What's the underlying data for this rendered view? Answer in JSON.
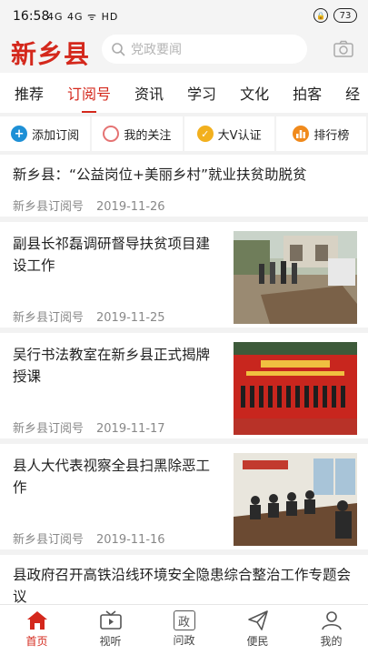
{
  "status_bar": {
    "time": "16:58",
    "signal_text": "4G 4G ᯤ HD",
    "battery": "73"
  },
  "header": {
    "logo": "新乡县",
    "search_placeholder": "党政要闻",
    "icons": [
      "search-icon",
      "camera-icon"
    ]
  },
  "tabs": [
    {
      "label": "推荐",
      "active": false
    },
    {
      "label": "订阅号",
      "active": true
    },
    {
      "label": "资讯",
      "active": false
    },
    {
      "label": "学习",
      "active": false
    },
    {
      "label": "文化",
      "active": false
    },
    {
      "label": "拍客",
      "active": false
    },
    {
      "label": "经",
      "active": false
    }
  ],
  "shortcuts": [
    {
      "label": "添加订阅",
      "icon": "plus-icon",
      "color": "#1e90d6"
    },
    {
      "label": "我的关注",
      "icon": "heart-circle-icon",
      "color": "#e57373"
    },
    {
      "label": "大V认证",
      "icon": "verified-v-icon",
      "color": "#f2b01e"
    },
    {
      "label": "排行榜",
      "icon": "ranking-icon",
      "color": "#f08a1c"
    }
  ],
  "articles": [
    {
      "title": "新乡县：“公益岗位+美丽乡村”就业扶贫助脱贫",
      "source": "新乡县订阅号",
      "date": "2019-11-26"
    },
    {
      "title": "副县长祁磊调研督导扶贫项目建设工作",
      "source": "新乡县订阅号",
      "date": "2019-11-25",
      "image": "construction-site-photo"
    },
    {
      "title": "吴行书法教室在新乡县正式揭牌授课",
      "source": "新乡县订阅号",
      "date": "2019-11-17",
      "image": "ceremony-stage-photo"
    },
    {
      "title": "县人大代表视察全县扫黑除恶工作",
      "source": "新乡县订阅号",
      "date": "2019-11-16",
      "image": "meeting-room-photo"
    },
    {
      "title": "县政府召开高铁沿线环境安全隐患综合整治工作专题会议"
    }
  ],
  "bottom_nav": [
    {
      "label": "首页",
      "icon": "home-icon",
      "active": true
    },
    {
      "label": "视听",
      "icon": "tv-icon",
      "active": false
    },
    {
      "label": "问政",
      "icon": "zheng-icon",
      "glyph": "政",
      "active": false
    },
    {
      "label": "便民",
      "icon": "paper-plane-icon",
      "active": false
    },
    {
      "label": "我的",
      "icon": "user-icon",
      "active": false
    }
  ],
  "colors": {
    "accent": "#d4281c",
    "background_gray": "#f2f2f2"
  }
}
